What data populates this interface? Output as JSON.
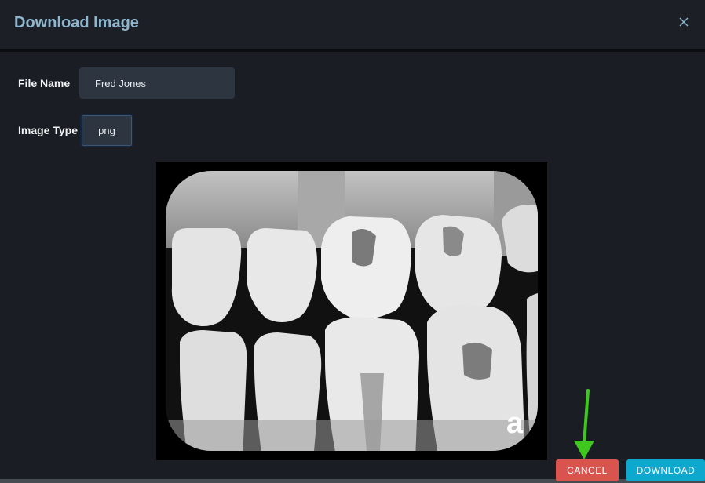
{
  "dialog": {
    "title": "Download Image"
  },
  "form": {
    "file_name_label": "File Name",
    "file_name_value": "Fred Jones",
    "image_type_label": "Image Type",
    "image_type_value": "png"
  },
  "preview": {
    "watermark": "a"
  },
  "actions": {
    "cancel_label": "CANCEL",
    "download_label": "DOWNLOAD"
  },
  "icons": {
    "close": "close-icon",
    "annotation": "arrow-down-icon"
  },
  "colors": {
    "title": "#8fb6cf",
    "cancel": "#d9534f",
    "download": "#0ea8cf",
    "annotation_arrow": "#3ec81e"
  }
}
